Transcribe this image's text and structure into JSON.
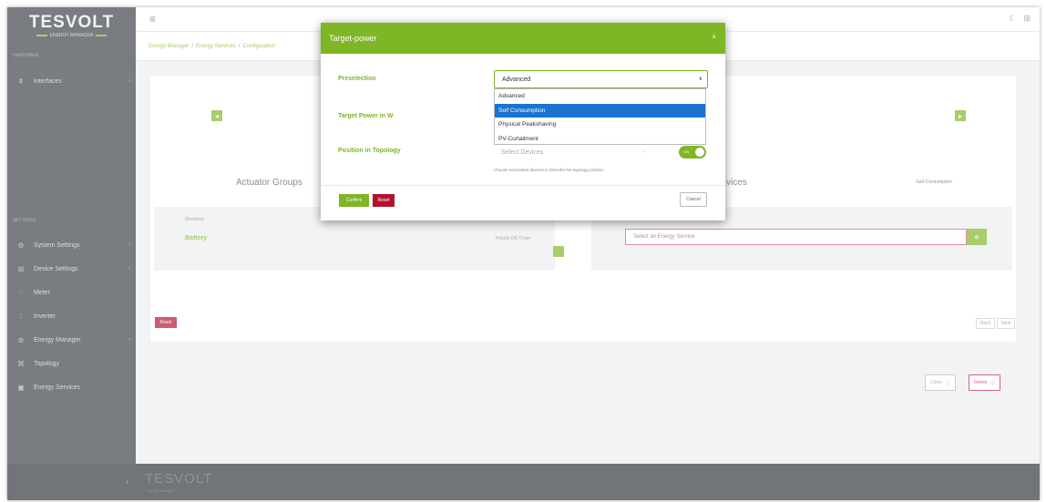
{
  "app": {
    "logo_text": "TESVOLT",
    "logo_sub": "ENERGY MANAGER",
    "footer_logo": "TESVOLT",
    "footer_sub": "Energy Manager"
  },
  "sidebar": {
    "section_top": "Hardware",
    "section_settings": "Settings",
    "items": [
      {
        "label": "Interfaces",
        "icon": "plug-icon"
      },
      {
        "label": "System Settings",
        "icon": "gear-icon"
      },
      {
        "label": "Device Settings",
        "icon": "devices-icon"
      },
      {
        "label": "Meter",
        "icon": "meter-icon"
      },
      {
        "label": "Inverter",
        "icon": "inverter-icon"
      },
      {
        "label": "Energy Manager",
        "icon": "energy-manager-icon"
      },
      {
        "label": "Topology",
        "icon": "topology-icon"
      },
      {
        "label": "Energy Services",
        "icon": "energy-services-icon"
      }
    ]
  },
  "breadcrumb": [
    "Energy Manager",
    "Energy Services",
    "Configuration"
  ],
  "main": {
    "actuator_groups_title": "Actuator Groups",
    "services_title_partial": "vices",
    "self_consumption_label": "Self-Consumption",
    "members_label": "Members",
    "battery_label": "Battery",
    "priority_label": "Priority 0% Order",
    "energy_service_placeholder": "Select an Energy Service",
    "clone_label": "Clone",
    "delete_label": "Delete",
    "reset_label": "Reset",
    "back_label": "Back",
    "next_label": "Next"
  },
  "modal": {
    "title": "Target-power",
    "preselection_label": "Preselection",
    "preselection_value": "Advanced",
    "target_power_label": "Target Power in W",
    "position_label": "Position in Topology",
    "devices_placeholder": "Select Devices",
    "toggle_label": "ON",
    "help_text": "Choose associated devices to describe the topology position.",
    "confirm_label": "Confirm",
    "reset_label": "Reset",
    "cancel_label": "Cancel",
    "dropdown_options": [
      "Advanced",
      "Self Consumption",
      "Physical Peakshaving",
      "PV-Curtailment"
    ],
    "dropdown_selected": "Self Consumption"
  },
  "colors": {
    "brand_green": "#7fb626",
    "danger_red": "#b3122e",
    "sidebar_bg": "#3a4047",
    "highlight_blue": "#1a73d1"
  }
}
